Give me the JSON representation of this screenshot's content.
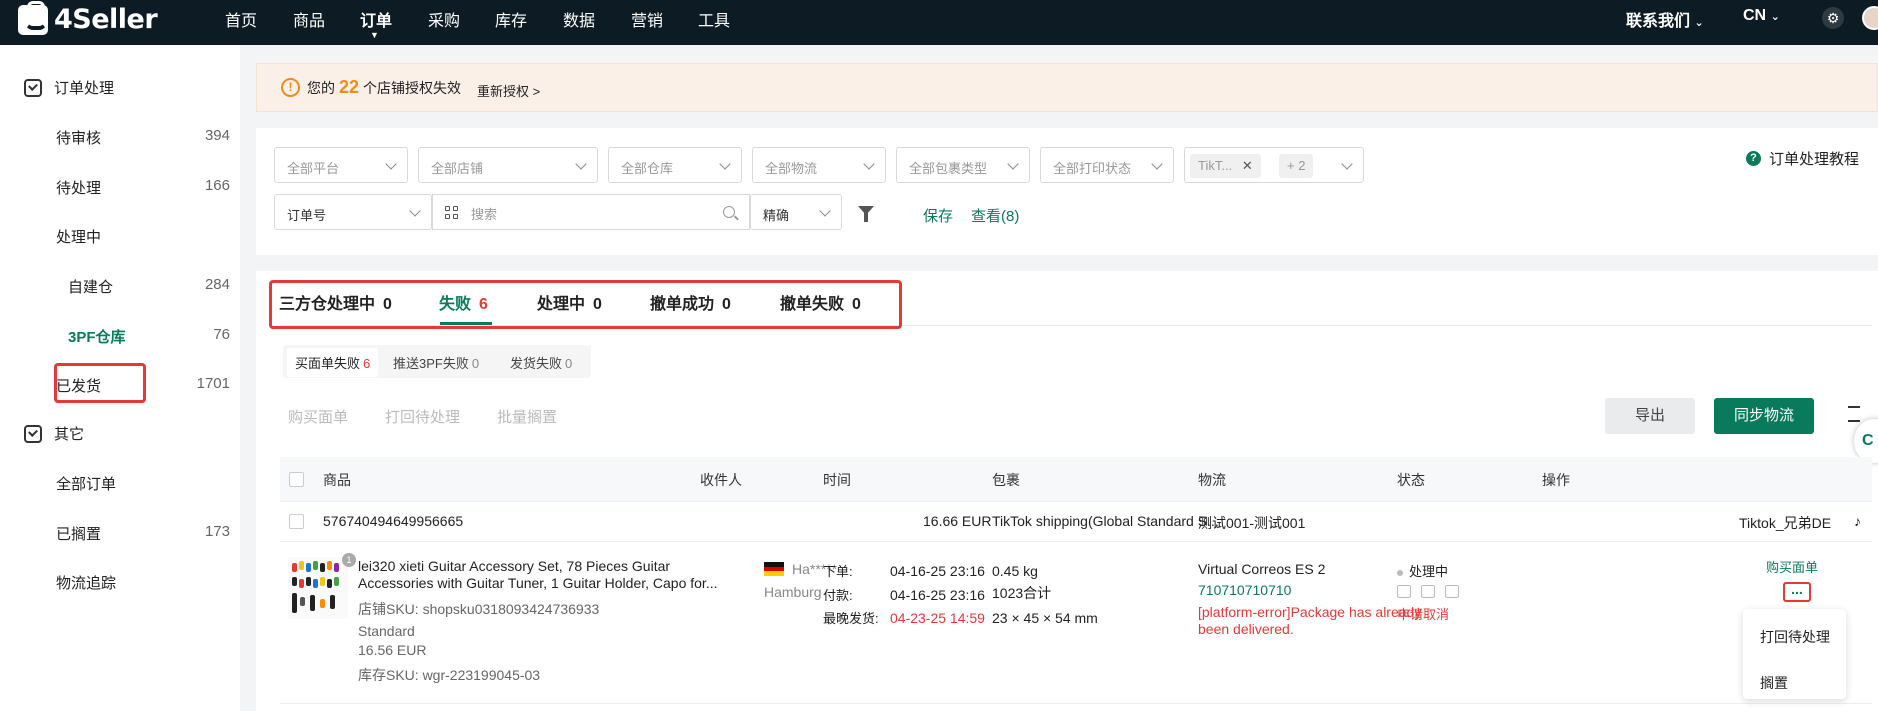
{
  "brand": "4Seller",
  "nav": [
    "首页",
    "商品",
    "订单",
    "采购",
    "库存",
    "数据",
    "营销",
    "工具"
  ],
  "nav_active": "订单",
  "topbar": {
    "contact": "联系我们",
    "lang": "CN"
  },
  "sidebar": {
    "group1": "订单处理",
    "items": [
      {
        "label": "待审核",
        "count": "394"
      },
      {
        "label": "待处理",
        "count": "166"
      },
      {
        "label": "处理中",
        "count": ""
      },
      {
        "label": "自建仓",
        "count": "284"
      },
      {
        "label": "3PF仓库",
        "count": "76"
      },
      {
        "label": "已发货",
        "count": "1701"
      }
    ],
    "group2": "其它",
    "items2": [
      {
        "label": "全部订单",
        "count": ""
      },
      {
        "label": "已搁置",
        "count": "173"
      },
      {
        "label": "物流追踪",
        "count": ""
      }
    ]
  },
  "banner": {
    "prefix": "您的",
    "count": "22",
    "suffix": "个店铺授权失效",
    "link": "重新授权 >"
  },
  "filters": {
    "platform": "全部平台",
    "store": "全部店铺",
    "warehouse": "全部仓库",
    "logistics": "全部物流",
    "package_type": "全部包裹类型",
    "print_status": "全部打印状态",
    "tag_value": "TikT...",
    "tag_more": "+ 2",
    "order_field": "订单号",
    "search_placeholder": "搜索",
    "match_mode": "精确",
    "save": "保存",
    "view": "查看(8)",
    "help": "订单处理教程"
  },
  "tabs": [
    {
      "label": "三方仓处理中",
      "count": "0"
    },
    {
      "label": "失败",
      "count": "6"
    },
    {
      "label": "处理中",
      "count": "0"
    },
    {
      "label": "撤单成功",
      "count": "0"
    },
    {
      "label": "撤单失败",
      "count": "0"
    }
  ],
  "subtabs": [
    {
      "label": "买面单失败",
      "count": "6"
    },
    {
      "label": "推送3PF失败",
      "count": "0"
    },
    {
      "label": "发货失败",
      "count": "0"
    }
  ],
  "actions": {
    "buy_label": "购买面单",
    "reprint": "打回待处理",
    "batch_hold": "批量搁置",
    "export": "导出",
    "sync": "同步物流"
  },
  "table": {
    "headers": [
      "商品",
      "收件人",
      "时间",
      "包裹",
      "物流",
      "状态",
      "操作"
    ],
    "group": {
      "order_id": "576740494649956665",
      "amount": "16.66 EUR",
      "shipping": "TikTok shipping(Global Standard S...",
      "logistics": "测试001-测试001",
      "store": "Tiktok_兄弟DE"
    },
    "row": {
      "qty_badge": "1",
      "title_line1": "lei320 xieti Guitar Accessory Set, 78 Pieces Guitar",
      "title_line2": "Accessories with Guitar Tuner, 1 Guitar Holder, Capo for...",
      "store_sku": "店铺SKU: shopsku0318093424736933",
      "variant": "Standard",
      "price": "16.56 EUR",
      "stock_sku": "库存SKU: wgr-223199045-03",
      "recipient": "Ha*****",
      "city": "Hamburg",
      "order_label": "下单:",
      "order_time": "04-16-25 23:16",
      "pay_label": "付款:",
      "pay_time": "04-16-25 23:16",
      "ship_label": "最晚发货:",
      "ship_time": "04-23-25 14:59",
      "weight": "0.45 kg",
      "qty": "1023合计",
      "dims": "23 × 45 × 54 mm",
      "carrier": "Virtual Correos ES 2",
      "tracking": "710710710710",
      "error_line1": "[platform-error]Package has already",
      "error_line2": "been delivered.",
      "status": "处理中",
      "cancel": "申请取消",
      "op_buy": "购买面单",
      "op_more": "...",
      "menu": [
        "打回待处理",
        "搁置"
      ]
    }
  },
  "colors": {
    "brand_green": "#0a7a5c",
    "error_red": "#e53935",
    "warn_orange": "#f08c1a",
    "topbar": "#0d1c24"
  }
}
